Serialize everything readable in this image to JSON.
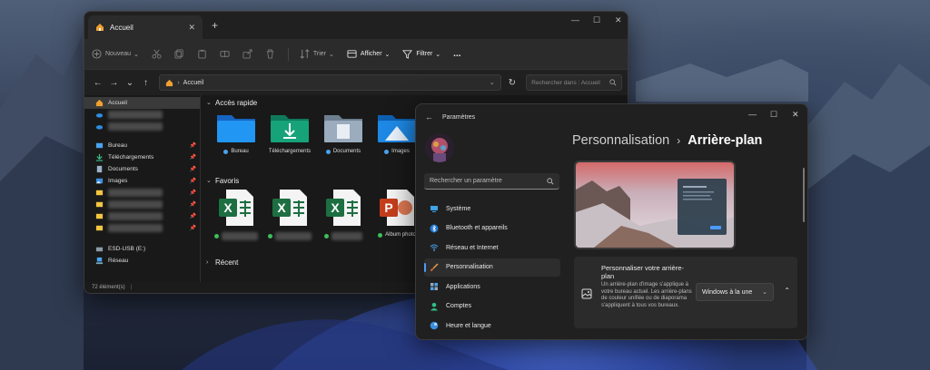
{
  "explorer": {
    "tab_title": "Accueil",
    "toolbar": {
      "new_label": "Nouveau",
      "sort_label": "Trier",
      "view_label": "Afficher",
      "filter_label": "Filtrer",
      "more_label": "..."
    },
    "address": {
      "path": "Accueil"
    },
    "search": {
      "placeholder": "Rechercher dans : Accueil"
    },
    "sidebar": {
      "home": "Accueil",
      "items": [
        {
          "label": "Bureau",
          "icon": "desktop-icon"
        },
        {
          "label": "Téléchargements",
          "icon": "download-icon"
        },
        {
          "label": "Documents",
          "icon": "documents-icon"
        },
        {
          "label": "Images",
          "icon": "images-icon"
        }
      ],
      "drives": [
        {
          "label": "ESD-USB (E:)",
          "icon": "usb-drive-icon"
        },
        {
          "label": "Réseau",
          "icon": "network-icon"
        }
      ]
    },
    "quick_access": {
      "header": "Accès rapide",
      "items": [
        {
          "label": "Bureau",
          "icon": "folder-desktop-icon"
        },
        {
          "label": "Téléchargements",
          "icon": "folder-download-icon"
        },
        {
          "label": "Documents",
          "icon": "folder-documents-icon"
        },
        {
          "label": "Images",
          "icon": "folder-images-icon"
        }
      ]
    },
    "favorites": {
      "header": "Favoris",
      "items": [
        {
          "label": "",
          "icon": "excel-icon"
        },
        {
          "label": "",
          "icon": "excel-icon"
        },
        {
          "label": "",
          "icon": "excel-icon"
        },
        {
          "label": "Album photo",
          "icon": "powerpoint-icon"
        }
      ]
    },
    "recent": {
      "header": "Récent"
    },
    "status": "72 élément(s)"
  },
  "settings": {
    "window_title": "Paramètres",
    "search_placeholder": "Rechercher un paramètre",
    "nav": [
      {
        "label": "Système",
        "icon": "system-icon"
      },
      {
        "label": "Bluetooth et appareils",
        "icon": "bluetooth-icon"
      },
      {
        "label": "Réseau et Internet",
        "icon": "wifi-icon"
      },
      {
        "label": "Personnalisation",
        "icon": "brush-icon",
        "selected": true
      },
      {
        "label": "Applications",
        "icon": "apps-icon"
      },
      {
        "label": "Comptes",
        "icon": "account-icon"
      },
      {
        "label": "Heure et langue",
        "icon": "globe-icon"
      }
    ],
    "breadcrumb": {
      "parent": "Personnalisation",
      "separator": "›",
      "current": "Arrière-plan"
    },
    "card": {
      "title": "Personnaliser votre arrière-plan",
      "description": "Un arrière-plan d'image s'applique à votre bureau actuel. Les arrière-plans de couleur unifiée ou de diaporama s'appliquent à tous vos bureaux.",
      "dropdown_value": "Windows à la une"
    }
  },
  "colors": {
    "accent": "#4c9aff",
    "excel_green": "#1d6f42",
    "powerpoint_red": "#c43e1c",
    "folder_blue": "#1e88e5",
    "folder_teal": "#16a085"
  }
}
